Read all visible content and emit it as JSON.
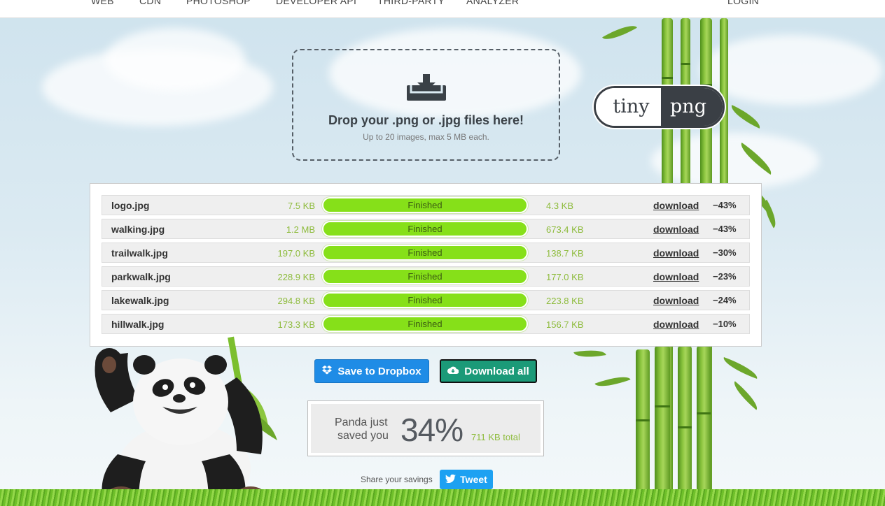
{
  "nav": {
    "items": [
      "WEB",
      "CDN",
      "PHOTOSHOP",
      "DEVELOPER API",
      "THIRD-PARTY",
      "ANALYZER"
    ],
    "login": "LOGIN"
  },
  "dropzone": {
    "icon": "download-tray-icon",
    "title": "Drop your .png or .jpg files here!",
    "subtitle": "Up to 20 images, max 5 MB each."
  },
  "logo": {
    "left": "tiny",
    "right": "png"
  },
  "files": [
    {
      "name": "logo.jpg",
      "before": "7.5 KB",
      "status": "Finished",
      "after": "4.3 KB",
      "action": "download",
      "saving": "−43%"
    },
    {
      "name": "walking.jpg",
      "before": "1.2 MB",
      "status": "Finished",
      "after": "673.4 KB",
      "action": "download",
      "saving": "−43%"
    },
    {
      "name": "trailwalk.jpg",
      "before": "197.0 KB",
      "status": "Finished",
      "after": "138.7 KB",
      "action": "download",
      "saving": "−30%"
    },
    {
      "name": "parkwalk.jpg",
      "before": "228.9 KB",
      "status": "Finished",
      "after": "177.0 KB",
      "action": "download",
      "saving": "−23%"
    },
    {
      "name": "lakewalk.jpg",
      "before": "294.8 KB",
      "status": "Finished",
      "after": "223.8 KB",
      "action": "download",
      "saving": "−24%"
    },
    {
      "name": "hillwalk.jpg",
      "before": "173.3 KB",
      "status": "Finished",
      "after": "156.7 KB",
      "action": "download",
      "saving": "−10%"
    }
  ],
  "buttons": {
    "dropbox": "Save to Dropbox",
    "dropbox_icon": "dropbox-icon",
    "download_all": "Download all",
    "download_all_icon": "cloud-download-icon"
  },
  "savings": {
    "label_line1": "Panda just",
    "label_line2": "saved you",
    "percent": "34%",
    "total": "711 KB total"
  },
  "share": {
    "label": "Share your savings",
    "tweet": "Tweet",
    "tweet_icon": "twitter-bird-icon"
  },
  "colors": {
    "progress": "#86e019",
    "size_text": "#8dbb3b",
    "dropbox": "#1f8ce6",
    "download_all": "#1b9a78",
    "tweet": "#1da1f2",
    "logo_dark": "#3a3f45"
  }
}
